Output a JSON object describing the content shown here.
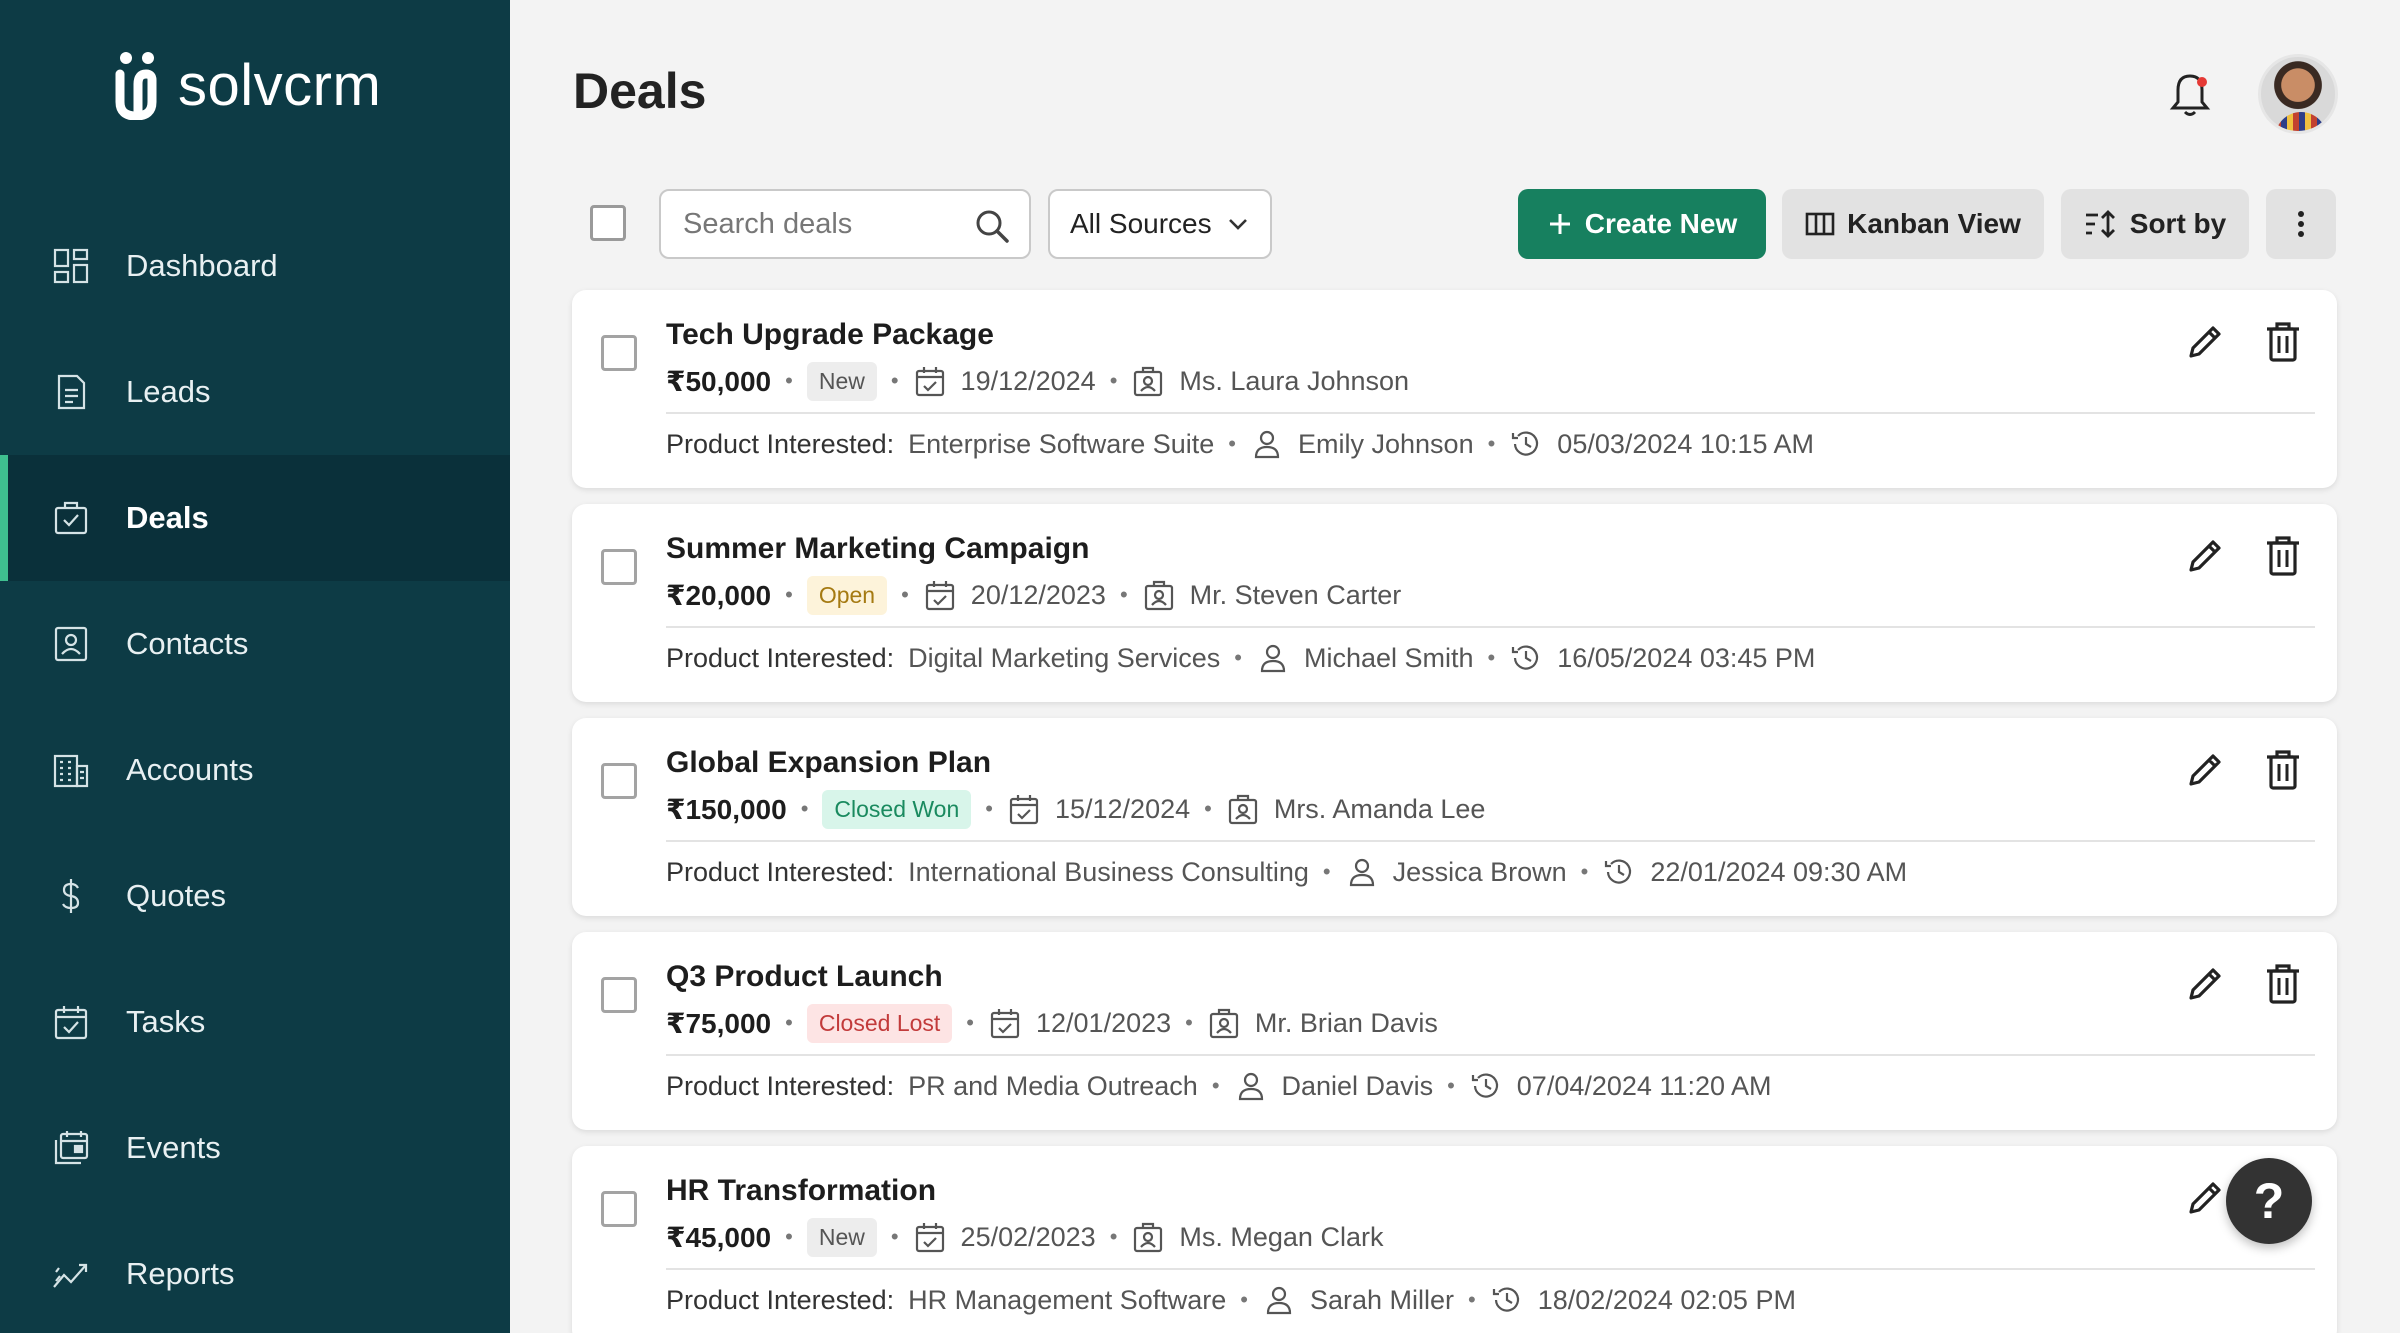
{
  "brand": {
    "name": "solvcrm"
  },
  "sidebar": {
    "items": [
      {
        "label": "Dashboard",
        "icon": "dashboard-icon",
        "active": false
      },
      {
        "label": "Leads",
        "icon": "document-icon",
        "active": false
      },
      {
        "label": "Deals",
        "icon": "deals-icon",
        "active": true
      },
      {
        "label": "Contacts",
        "icon": "contact-card-icon",
        "active": false
      },
      {
        "label": "Accounts",
        "icon": "building-icon",
        "active": false
      },
      {
        "label": "Quotes",
        "icon": "dollar-icon",
        "active": false
      },
      {
        "label": "Tasks",
        "icon": "calendar-check-icon",
        "active": false
      },
      {
        "label": "Events",
        "icon": "events-icon",
        "active": false
      },
      {
        "label": "Reports",
        "icon": "trend-icon",
        "active": false
      }
    ]
  },
  "header": {
    "title": "Deals"
  },
  "toolbar": {
    "search_placeholder": "Search deals",
    "sources_value": "All Sources",
    "create_label": "Create New",
    "kanban_label": "Kanban View",
    "sort_label": "Sort by"
  },
  "deals": [
    {
      "title": "Tech Upgrade Package",
      "amount": "₹50,000",
      "status": "New",
      "status_type": "new",
      "date": "19/12/2024",
      "contact": "Ms. Laura Johnson",
      "product_label": "Product Interested:",
      "product": "Enterprise Software Suite",
      "owner": "Emily Johnson",
      "updated": "05/03/2024 10:15 AM"
    },
    {
      "title": "Summer Marketing Campaign",
      "amount": "₹20,000",
      "status": "Open",
      "status_type": "open",
      "date": "20/12/2023",
      "contact": "Mr. Steven Carter",
      "product_label": "Product Interested:",
      "product": "Digital Marketing Services",
      "owner": "Michael Smith",
      "updated": "16/05/2024 03:45 PM"
    },
    {
      "title": "Global Expansion Plan",
      "amount": "₹150,000",
      "status": "Closed Won",
      "status_type": "won",
      "date": "15/12/2024",
      "contact": "Mrs. Amanda Lee",
      "product_label": "Product Interested:",
      "product": "International Business Consulting",
      "owner": "Jessica Brown",
      "updated": "22/01/2024 09:30 AM"
    },
    {
      "title": "Q3 Product Launch",
      "amount": "₹75,000",
      "status": "Closed Lost",
      "status_type": "lost",
      "date": "12/01/2023",
      "contact": "Mr. Brian Davis",
      "product_label": "Product Interested:",
      "product": "PR and Media Outreach",
      "owner": "Daniel Davis",
      "updated": "07/04/2024 11:20 AM"
    },
    {
      "title": "HR Transformation",
      "amount": "₹45,000",
      "status": "New",
      "status_type": "new",
      "date": "25/02/2023",
      "contact": "Ms. Megan Clark",
      "product_label": "Product Interested:",
      "product": "HR Management Software",
      "owner": "Sarah Miller",
      "updated": "18/02/2024 02:05 PM"
    }
  ],
  "help": {
    "label": "?"
  },
  "colors": {
    "sidebar": "#0d3b45",
    "accent": "#17805f",
    "active_bar": "#3fbf8f"
  }
}
